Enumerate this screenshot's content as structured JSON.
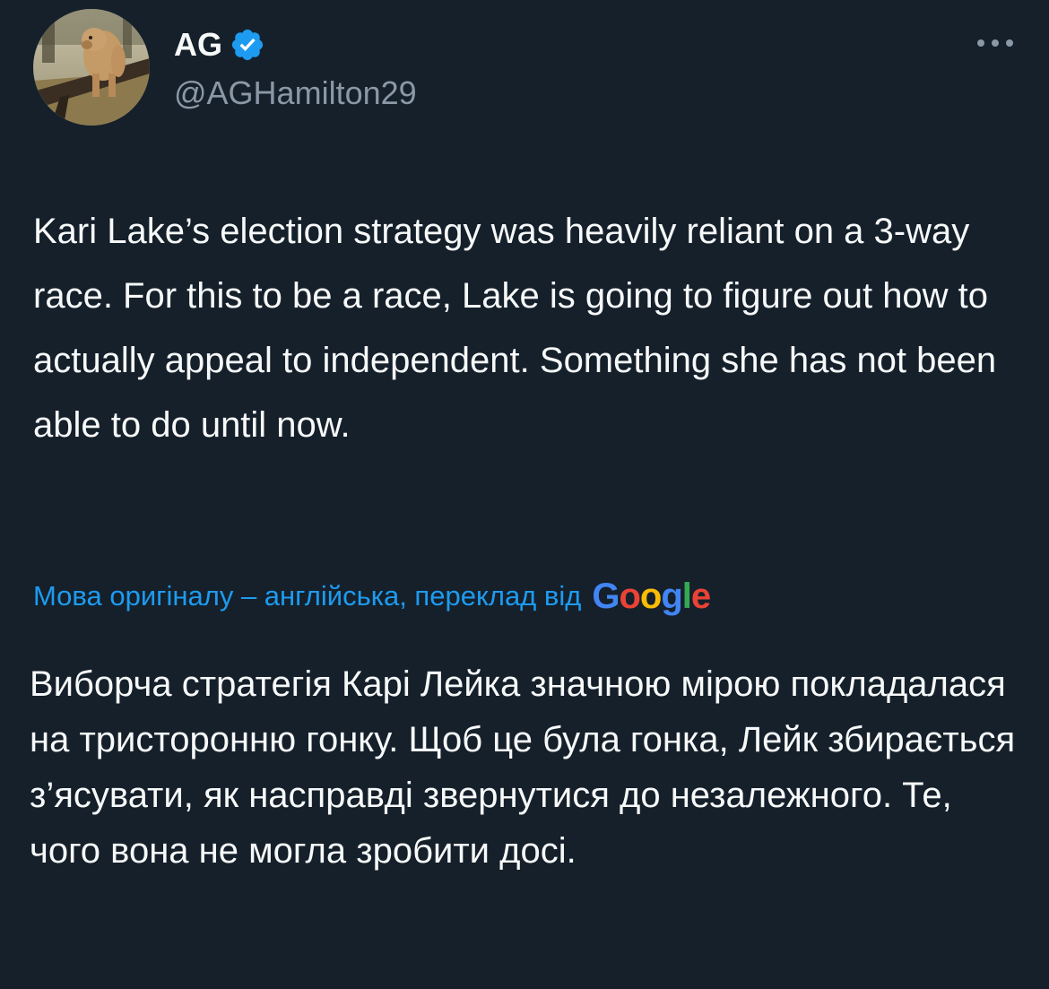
{
  "author": {
    "display_name": "AG",
    "handle": "@AGHamilton29",
    "verified_icon": "verified-badge-icon",
    "verified_color": "#1d9bf0",
    "avatar_icon": "dog-photo-avatar"
  },
  "more_icon": "more-options-icon",
  "tweet": {
    "text": "Kari Lake’s election strategy was heavily reliant on a 3-way race. For this to be a race, Lake is going to figure out how to actually appeal to independent. Something she has not been able to do until now."
  },
  "translation": {
    "label": "Мова оригіналу – англійська, переклад від",
    "provider": "Google",
    "provider_letters": [
      {
        "ch": "G",
        "color": "#4285f4"
      },
      {
        "ch": "o",
        "color": "#ea4335"
      },
      {
        "ch": "o",
        "color": "#fbbc05"
      },
      {
        "ch": "g",
        "color": "#4285f4"
      },
      {
        "ch": "l",
        "color": "#34a853"
      },
      {
        "ch": "e",
        "color": "#ea4335"
      }
    ],
    "text": "Виборча стратегія Карі Лейка значною мірою покладалася на тристоронню гонку. Щоб це була гонка, Лейк збирається з’ясувати, як насправді звернутися до незалежного. Те, чого вона не могла зробити досі."
  },
  "colors": {
    "background": "#15202b",
    "text_primary": "#f7f9f9",
    "text_secondary": "#8b98a5",
    "link": "#1d9bf0"
  }
}
